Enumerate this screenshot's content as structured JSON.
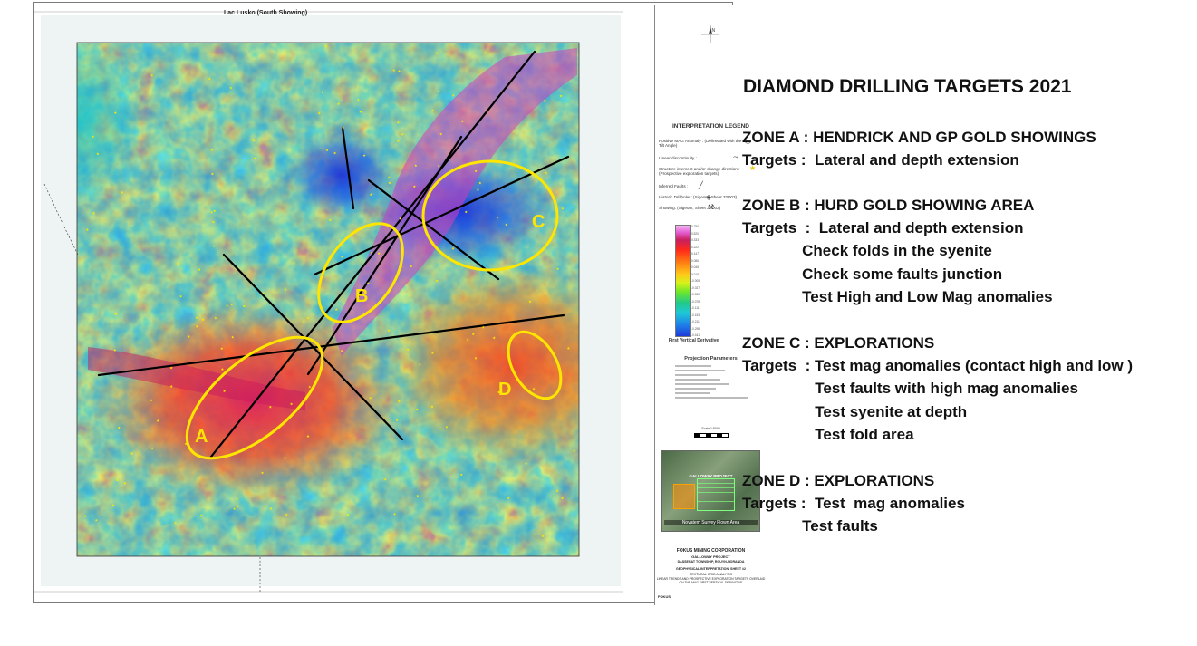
{
  "map": {
    "sheet_label": "Lac Lusko (South Showing)",
    "zone_labels": [
      "A",
      "B",
      "C",
      "D"
    ],
    "colors": {
      "target_ellipse": "#ffe600",
      "trend_lines": "#000000"
    }
  },
  "legend": {
    "title": "INTERPRETATION LEGEND",
    "items": [
      {
        "label": "Positive MAG Anomaly : (Delineated with the Tilt Angle)",
        "icon": "dashed-ellipse-icon"
      },
      {
        "label": "Linear discontinuity :",
        "icon": "dashed-line-icon"
      },
      {
        "label": "Structure intercept and/or change direction : (Prospective exploration targets)",
        "icon": "star-icon"
      },
      {
        "label": "Inferred Faults :",
        "icon": "fault-line-icon"
      },
      {
        "label": "Historic Drillholes: (Sigeom, Sheet 32D03)",
        "icon": "drillhole-icon"
      },
      {
        "label": "Showing: (Sigeom, Sheet 32D03)",
        "icon": "showing-pickaxe-icon"
      }
    ],
    "colorbar_label": "First Vertical Derivative",
    "colorbar_ticks": [
      "0.750",
      "0.520",
      "0.333",
      "0.222",
      "0.147",
      "0.086",
      "0.046",
      "0.018",
      "-0.005",
      "-0.027",
      "-0.050",
      "-0.078",
      "-0.111",
      "-0.153",
      "-0.211",
      "-0.298",
      "-0.441"
    ],
    "projection_title": "Projection Parameters",
    "scale_label": "Scale 1:5000"
  },
  "inset": {
    "title": "GALLOWAY PROJECT",
    "caption": "Novatem Survey Flown Area"
  },
  "title_block": {
    "company": "FOKUS MINING CORPORATION",
    "project": "GALLOWAY PROJECT",
    "township": "DASSERAT TOWNSHIP, ROUYN-NORANDA",
    "sheet": "GEOPHYSICAL INTERPRETATION, SHEET #2",
    "grid": "TEXTURAL GRID ANALYSIS",
    "trends": "LINEAR TRENDS AND PROSPECTIVE EXPLORATION TARGETS OVERLAID ON THE MAG FIRST VERTICAL DERIVATIVE",
    "logo": "FOKUS"
  },
  "targets_panel": {
    "title": "DIAMOND DRILLING TARGETS 2021",
    "zones": [
      {
        "heading": "ZONE A : HENDRICK AND GP GOLD SHOWINGS",
        "lines": [
          "Targets :  Lateral and depth extension"
        ]
      },
      {
        "heading": "ZONE B :  HURD GOLD SHOWING AREA",
        "lines": [
          "Targets  :  Lateral and depth extension",
          "              Check folds in the syenite",
          "              Check some faults junction",
          "              Test High and Low Mag anomalies"
        ]
      },
      {
        "heading": "ZONE C :  EXPLORATIONS",
        "lines": [
          "Targets  : Test mag anomalies (contact high and low )",
          "                 Test faults with high mag anomalies",
          "                 Test syenite at depth",
          "                 Test fold area"
        ]
      },
      {
        "heading": "ZONE D :  EXPLORATIONS",
        "lines": [
          "Targets :  Test  mag anomalies",
          "              Test faults"
        ]
      }
    ]
  }
}
